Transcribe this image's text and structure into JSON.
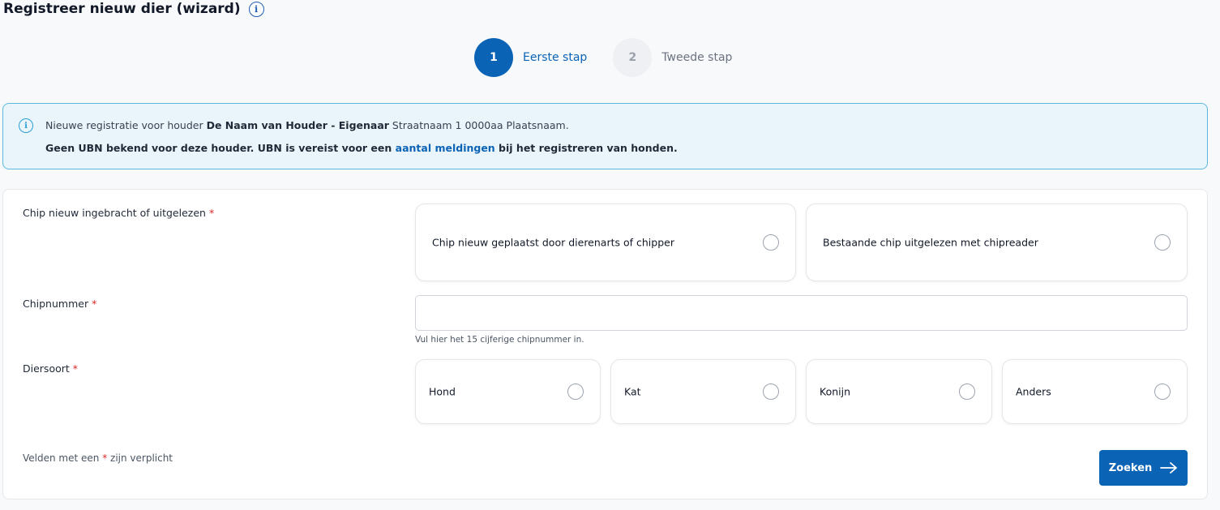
{
  "page": {
    "title": "Registreer nieuw dier (wizard)",
    "info_glyph": "i"
  },
  "stepper": {
    "steps": [
      {
        "number": "1",
        "label": "Eerste stap",
        "state": "active"
      },
      {
        "number": "2",
        "label": "Tweede stap",
        "state": "inactive"
      }
    ]
  },
  "alert": {
    "icon": "info-icon",
    "line1_prefix": "Nieuwe registratie voor houder ",
    "holder_name": "De Naam van Houder - Eigenaar",
    "holder_address": " Straatnaam 1 0000aa Plaatsnaam.",
    "line2_prefix": "Geen UBN bekend voor deze houder. UBN is vereist voor een ",
    "line2_link": "aantal meldingen",
    "line2_suffix": " bij het registreren van honden."
  },
  "form": {
    "required_marker": "*",
    "chip_source": {
      "label": "Chip nieuw ingebracht of uitgelezen",
      "options": [
        "Chip nieuw geplaatst door dierenarts of chipper",
        "Bestaande chip uitgelezen met chipreader"
      ]
    },
    "chip_number": {
      "label": "Chipnummer",
      "value": "",
      "placeholder": "",
      "hint": "Vul hier het 15 cijferige chipnummer in."
    },
    "species": {
      "label": "Diersoort",
      "options": [
        "Hond",
        "Kat",
        "Konijn",
        "Anders"
      ]
    },
    "footer_prefix": "Velden met een ",
    "footer_suffix": " zijn verplicht",
    "submit_label": "Zoeken"
  },
  "colors": {
    "primary": "#0b63b6",
    "alert_bg": "#eaf5fb",
    "alert_border": "#5bb8dd",
    "required": "#dc2626"
  }
}
